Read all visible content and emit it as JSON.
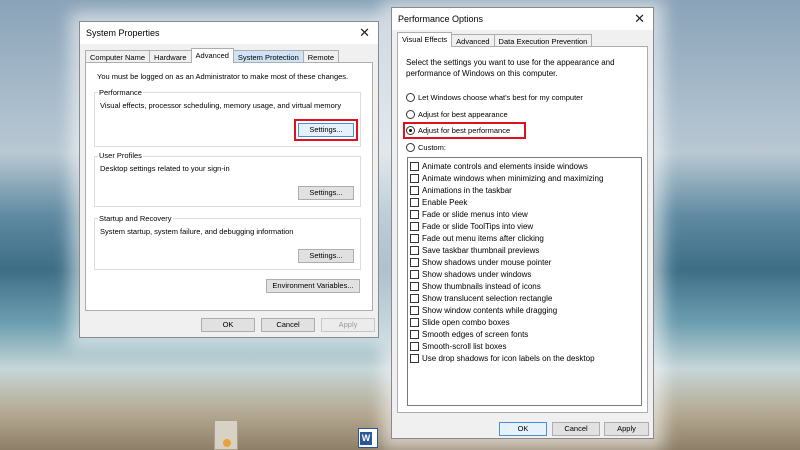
{
  "system_properties": {
    "title": "System Properties",
    "tabs": [
      "Computer Name",
      "Hardware",
      "Advanced",
      "System Protection",
      "Remote"
    ],
    "admin_note": "You must be logged on as an Administrator to make most of these changes.",
    "performance": {
      "title": "Performance",
      "desc": "Visual effects, processor scheduling, memory usage, and virtual memory",
      "button": "Settings..."
    },
    "user_profiles": {
      "title": "User Profiles",
      "desc": "Desktop settings related to your sign-in",
      "button": "Settings..."
    },
    "startup_recovery": {
      "title": "Startup and Recovery",
      "desc": "System startup, system failure, and debugging information",
      "button": "Settings..."
    },
    "env_button": "Environment Variables...",
    "ok": "OK",
    "cancel": "Cancel",
    "apply": "Apply"
  },
  "performance_options": {
    "title": "Performance Options",
    "tabs": [
      "Visual Effects",
      "Advanced",
      "Data Execution Prevention"
    ],
    "intro_line1": "Select the settings you want to use for the appearance and",
    "intro_line2": "performance of Windows on this computer.",
    "radios": [
      {
        "label": "Let Windows choose what's best for my computer",
        "checked": false
      },
      {
        "label": "Adjust for best appearance",
        "checked": false
      },
      {
        "label": "Adjust for best performance",
        "checked": true
      },
      {
        "label": "Custom:",
        "checked": false
      }
    ],
    "checkboxes": [
      "Animate controls and elements inside windows",
      "Animate windows when minimizing and maximizing",
      "Animations in the taskbar",
      "Enable Peek",
      "Fade or slide menus into view",
      "Fade or slide ToolTips into view",
      "Fade out menu items after clicking",
      "Save taskbar thumbnail previews",
      "Show shadows under mouse pointer",
      "Show shadows under windows",
      "Show thumbnails instead of icons",
      "Show translucent selection rectangle",
      "Show window contents while dragging",
      "Slide open combo boxes",
      "Smooth edges of screen fonts",
      "Smooth-scroll list boxes",
      "Use drop shadows for icon labels on the desktop"
    ],
    "ok": "OK",
    "cancel": "Cancel",
    "apply": "Apply"
  },
  "colors": {
    "highlight_box": "#e0101e",
    "dialog_bg": "#f0f0f0",
    "selected_tab": "#cfe3f6"
  },
  "icons": [
    "close-icon",
    "word-icon",
    "folder-icon"
  ]
}
